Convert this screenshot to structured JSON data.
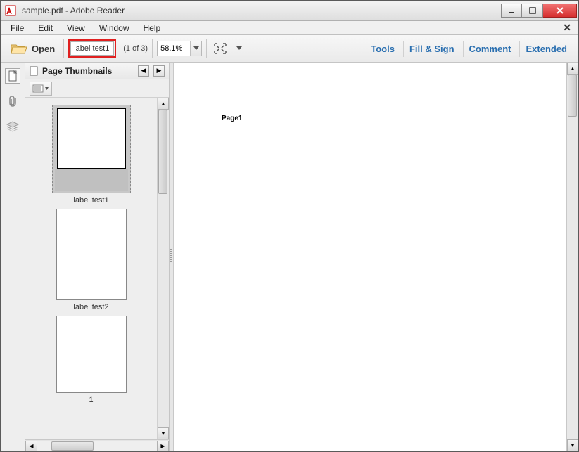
{
  "title": "sample.pdf - Adobe Reader",
  "menubar": {
    "file": "File",
    "edit": "Edit",
    "view": "View",
    "window": "Window",
    "help": "Help"
  },
  "toolbar": {
    "open_label": "Open",
    "page_input": "label test1",
    "page_count": "(1 of 3)",
    "zoom": "58.1%"
  },
  "right_links": {
    "tools": "Tools",
    "fill_sign": "Fill & Sign",
    "comment": "Comment",
    "extended": "Extended"
  },
  "thumbs": {
    "title": "Page Thumbnails",
    "items": [
      {
        "label": "label test1",
        "mini": "."
      },
      {
        "label": "label test2",
        "mini": "."
      },
      {
        "label": "1",
        "mini": "."
      }
    ]
  },
  "page": {
    "content": "Page1"
  }
}
